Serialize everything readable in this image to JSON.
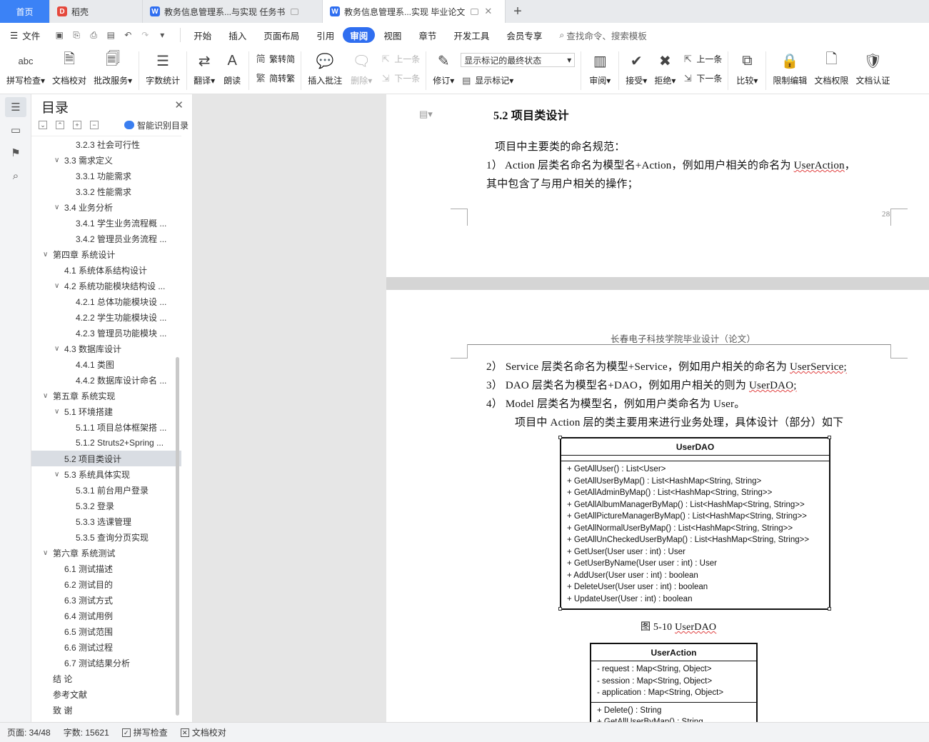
{
  "tabs": [
    {
      "label": "首页",
      "kind": "home"
    },
    {
      "label": "稻壳",
      "kind": "docer"
    },
    {
      "label": "教务信息管理系...与实现 任务书",
      "kind": "doc"
    },
    {
      "label": "教务信息管理系...实现 毕业论文",
      "kind": "doc-active"
    }
  ],
  "menu": {
    "file": "文件",
    "items": [
      "开始",
      "插入",
      "页面布局",
      "引用",
      "审阅",
      "视图",
      "章节",
      "开发工具",
      "会员专享"
    ],
    "active": "审阅",
    "search": "查找命令、搜索模板"
  },
  "ribbon": {
    "spell_abc": "abc",
    "spell_check": "拼写检查",
    "doc_check": "文档校对",
    "batch_service": "批改服务",
    "word_count": "字数统计",
    "translate": "翻译",
    "read_aloud": "朗读",
    "to_simplified": "繁转简",
    "to_traditional": "简转繁",
    "insert_comment": "插入批注",
    "delete": "删除",
    "prev": "上一条",
    "next": "下一条",
    "revise": "修订",
    "markup_select": "显示标记的最终状态",
    "show_markup": "显示标记",
    "review": "审阅",
    "accept": "接受",
    "reject": "拒绝",
    "prev2": "上一条",
    "next2": "下一条",
    "compare": "比较",
    "restrict_edit": "限制编辑",
    "doc_permission": "文档权限",
    "doc_cert": "文档认证"
  },
  "toc": {
    "title": "目录",
    "smart": "智能识别目录",
    "items": [
      {
        "text": "3.2.3  社会可行性",
        "level": 3,
        "arrow": ""
      },
      {
        "text": "3.3  需求定义",
        "level": 2,
        "arrow": "v"
      },
      {
        "text": "3.3.1  功能需求",
        "level": 3,
        "arrow": ""
      },
      {
        "text": "3.3.2  性能需求",
        "level": 3,
        "arrow": ""
      },
      {
        "text": "3.4  业务分析",
        "level": 2,
        "arrow": "v"
      },
      {
        "text": "3.4.1  学生业务流程概 ...",
        "level": 3,
        "arrow": ""
      },
      {
        "text": "3.4.2  管理员业务流程 ...",
        "level": 3,
        "arrow": ""
      },
      {
        "text": "第四章  系统设计",
        "level": 1,
        "arrow": "v"
      },
      {
        "text": "4.1  系统体系结构设计",
        "level": 2,
        "arrow": ""
      },
      {
        "text": "4.2  系统功能模块结构设 ...",
        "level": 2,
        "arrow": "v"
      },
      {
        "text": "4.2.1  总体功能模块设 ...",
        "level": 3,
        "arrow": ""
      },
      {
        "text": "4.2.2  学生功能模块设 ...",
        "level": 3,
        "arrow": ""
      },
      {
        "text": "4.2.3  管理员功能模块 ...",
        "level": 3,
        "arrow": ""
      },
      {
        "text": "4.3  数据库设计",
        "level": 2,
        "arrow": "v"
      },
      {
        "text": "4.4.1  类图",
        "level": 3,
        "arrow": ""
      },
      {
        "text": "4.4.2  数据库设计命名 ...",
        "level": 3,
        "arrow": ""
      },
      {
        "text": "第五章  系统实现",
        "level": 1,
        "arrow": "v"
      },
      {
        "text": "5.1  环境搭建",
        "level": 2,
        "arrow": "v"
      },
      {
        "text": "5.1.1  项目总体框架搭 ...",
        "level": 3,
        "arrow": ""
      },
      {
        "text": "5.1.2 Struts2+Spring ...",
        "level": 3,
        "arrow": ""
      },
      {
        "text": "5.2  项目类设计",
        "level": 2,
        "arrow": "",
        "selected": true
      },
      {
        "text": "5.3  系统具体实现",
        "level": 2,
        "arrow": "v"
      },
      {
        "text": "5.3.1  前台用户登录",
        "level": 3,
        "arrow": ""
      },
      {
        "text": "5.3.2  登录",
        "level": 3,
        "arrow": ""
      },
      {
        "text": "5.3.3  选课管理",
        "level": 3,
        "arrow": ""
      },
      {
        "text": "5.3.5  查询分页实现",
        "level": 3,
        "arrow": ""
      },
      {
        "text": "第六章  系统测试",
        "level": 1,
        "arrow": "v"
      },
      {
        "text": "6.1  测试描述",
        "level": 2,
        "arrow": ""
      },
      {
        "text": "6.2  测试目的",
        "level": 2,
        "arrow": ""
      },
      {
        "text": "6.3  测试方式",
        "level": 2,
        "arrow": ""
      },
      {
        "text": "6.4  测试用例",
        "level": 2,
        "arrow": ""
      },
      {
        "text": "6.5  测试范围",
        "level": 2,
        "arrow": ""
      },
      {
        "text": "6.6  测试过程",
        "level": 2,
        "arrow": ""
      },
      {
        "text": "6.7  测试结果分析",
        "level": 2,
        "arrow": ""
      },
      {
        "text": "结    论",
        "level": 1,
        "arrow": ""
      },
      {
        "text": "参考文献",
        "level": 1,
        "arrow": ""
      },
      {
        "text": "致    谢",
        "level": 1,
        "arrow": ""
      }
    ]
  },
  "page1": {
    "heading": "5.2  项目类设计",
    "p1": "项目中主要类的命名规范：",
    "p2a": "1）  Action 层类名命名为模型名+Action，例如用户相关的命名为 ",
    "p2b": "UserAction",
    "p2c": "，",
    "p3": "其中包含了与用户相关的操作；",
    "page_num": "28"
  },
  "page2": {
    "header": "长春电子科技学院毕业设计（论文）",
    "l2a": "2）  Service 层类名命名为模型+Service，例如用户相关的命名为 ",
    "l2b": "UserService;",
    "l3a": "3）  DAO 层类名为模型名+DAO，例如用户相关的则为 ",
    "l3b": "UserDAO;",
    "l4": "4）  Model 层类名为模型名，例如用户类命名为 User。",
    "l5": "项目中 Action 层的类主要用来进行业务处理，具体设计（部分）如下",
    "uml1": {
      "name": "UserDAO",
      "methods": [
        "+ GetAllUser() : List<User>",
        "+ GetAllUserByMap() : List<HashMap<String, String>",
        "+ GetAllAdminByMap() : List<HashMap<String, String>>",
        "+ GetAllAlbumManagerByMap() : List<HashMap<String, String>>",
        "+ GetAllPictureManagerByMap() : List<HashMap<String, String>>",
        "+ GetAllNormalUserByMap() : List<HashMap<String, String>>",
        "+ GetAllUnCheckedUserByMap() : List<HashMap<String, String>>",
        "+ GetUser(User user : int) : User",
        "+ GetUserByName(User user : int) : User",
        "+ AddUser(User user : int) : boolean",
        "+ DeleteUser(User user : int) : boolean",
        "+ UpdateUser(User : int) : boolean"
      ]
    },
    "caption_a": "图 5-10 ",
    "caption_b": "UserDAO",
    "uml2": {
      "name": "UserAction",
      "attrs": [
        "- request : Map<String, Object>",
        "- session : Map<String, Object>",
        "- application : Map<String, Object>"
      ],
      "methods": [
        "+ Delete() : String",
        "+ GetAllUserByMap() : String"
      ]
    }
  },
  "status": {
    "page": "页面: 34/48",
    "words": "字数: 15621",
    "spell": "拼写检查",
    "proof": "文档校对"
  }
}
